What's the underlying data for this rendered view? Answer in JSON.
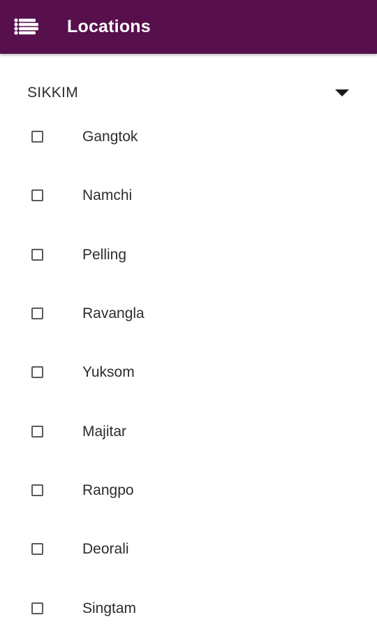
{
  "app_bar": {
    "title": "Locations",
    "menu_icon": "list-menu-icon",
    "background_color": "#58104d",
    "title_color": "#ffffff"
  },
  "region": {
    "name": "SIKKIM",
    "expand_icon": "caret-down-icon"
  },
  "locations": [
    {
      "label": "Gangtok",
      "checked": false
    },
    {
      "label": "Namchi",
      "checked": false
    },
    {
      "label": "Pelling",
      "checked": false
    },
    {
      "label": "Ravangla",
      "checked": false
    },
    {
      "label": "Yuksom",
      "checked": false
    },
    {
      "label": "Majitar",
      "checked": false
    },
    {
      "label": "Rangpo",
      "checked": false
    },
    {
      "label": "Deorali",
      "checked": false
    },
    {
      "label": "Singtam",
      "checked": false
    }
  ]
}
